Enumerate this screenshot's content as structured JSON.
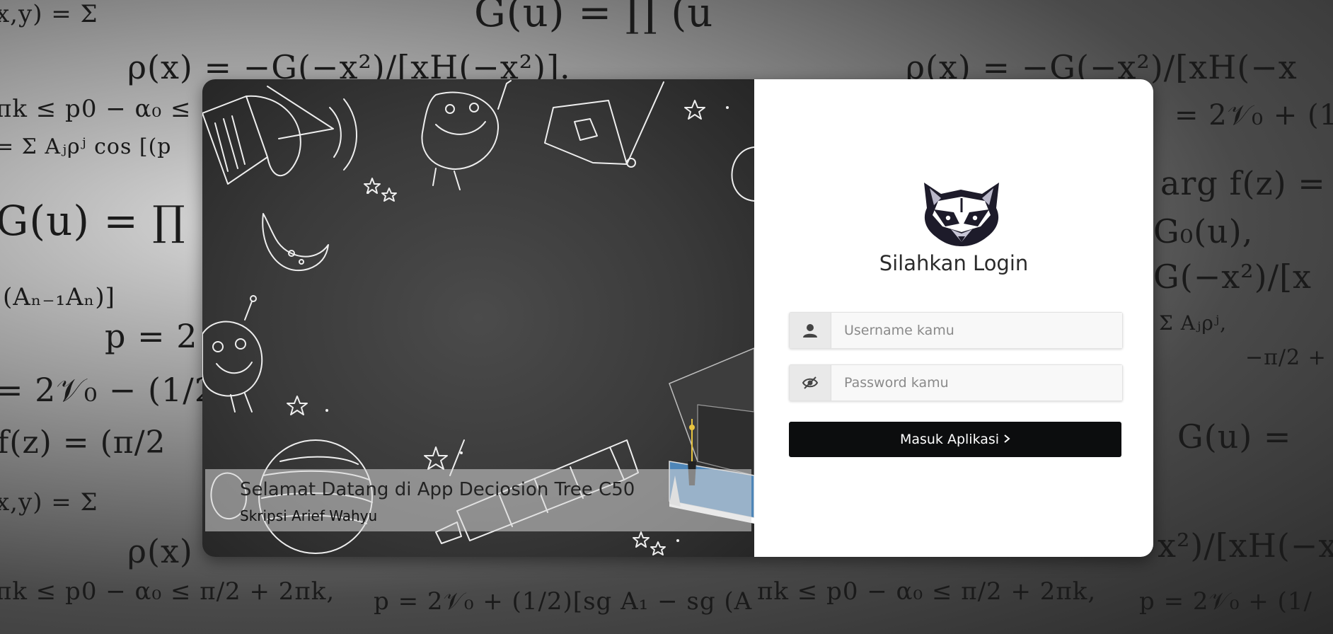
{
  "welcome": {
    "title": "Selamat Datang di App Deciosion Tree C50",
    "subtitle": "Skripsi Arief Wahyu"
  },
  "login": {
    "heading": "Silahkan Login",
    "username_placeholder": "Username kamu",
    "password_placeholder": "Password kamu",
    "submit_label": "Masuk Aplikasi",
    "submit_icon": "chevron-right-icon"
  },
  "icons": {
    "username": "user-icon",
    "password": "eye-slash-icon",
    "logo": "raccoon-logo"
  },
  "background": {
    "equations": [
      "x,y) = Σ",
      "G(u) = ∏ (u",
      "ρ(x) = −G(−x²)/[xH(−x²)].",
      "πk ≤ p0 − α₀ ≤",
      "= Σ Aⱼρʲ cos [(p",
      "G(u) = ∏",
      "(Aₙ₋₁Aₙ)]",
      "p = 2",
      "= 2𝒱₀ − (1/2",
      "f(z) = (π/2",
      "x,y) = Σ",
      "ρ(x)",
      "πk ≤ p0 − α₀ ≤ π/2 + 2πk,",
      "p = 2𝒱₀ + (1/2)[sg A₁ − sg (A",
      "πk ≤ p0 − α₀ ≤ π/2 + 2πk,",
      "p = 2𝒱₀ + (1/",
      "ρ(x) = −G(−x²)/[xH(−x",
      "= 2𝒱₀ + (1/",
      "arg f(z) =",
      "G₀(u),",
      "G(−x²)/[x",
      "Σ Aⱼρʲ,",
      "−π/2 +",
      "G(u) =",
      "x²)/[xH(−x"
    ]
  }
}
